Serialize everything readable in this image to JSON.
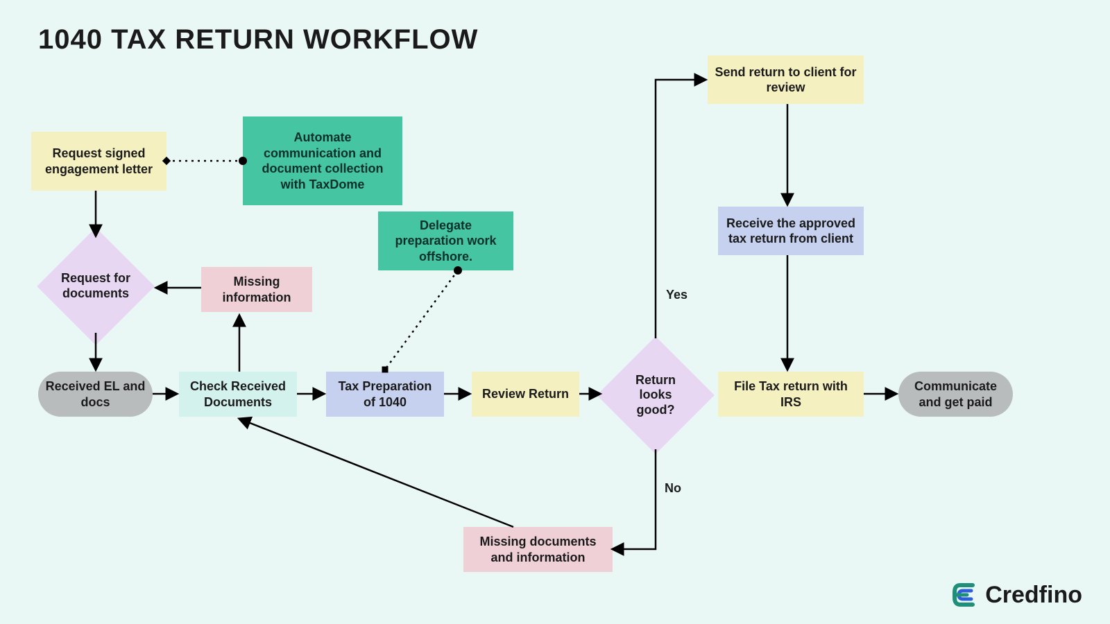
{
  "title": "1040 TAX RETURN WORKFLOW",
  "nodes": {
    "n1": "Request signed engagement letter",
    "n2": "Automate communication and document collection with TaxDome",
    "n3": "Request for documents",
    "n4": "Missing information",
    "n5": "Delegate preparation work offshore.",
    "n6": "Received EL and docs",
    "n7": "Check Received Documents",
    "n8": "Tax Preparation of 1040",
    "n9": "Review Return",
    "n10": "Return looks good?",
    "n11": "Send return to client for review",
    "n12": "Receive the approved tax return from client",
    "n13": "File Tax return with IRS",
    "n14": "Communicate and get paid",
    "n15": "Missing documents and information"
  },
  "edges": {
    "yes": "Yes",
    "no": "No"
  },
  "brand": "Credfino"
}
